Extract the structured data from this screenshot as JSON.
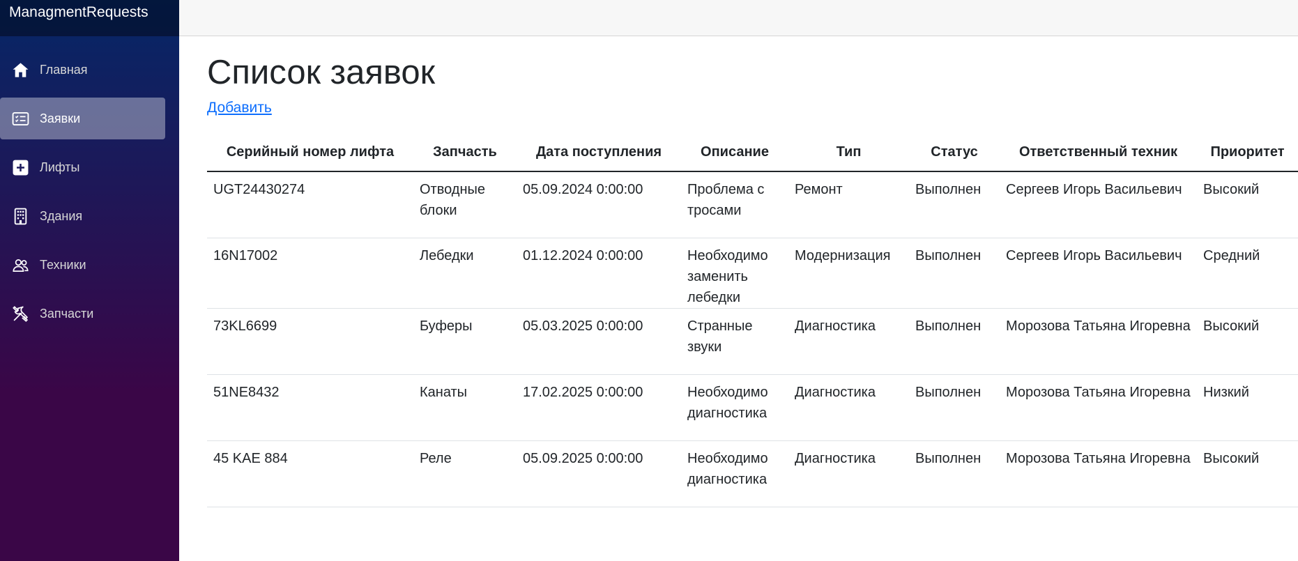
{
  "brand": "ManagmentRequests",
  "nav": [
    {
      "label": "Главная",
      "icon": "home-icon",
      "active": false
    },
    {
      "label": "Заявки",
      "icon": "list-icon",
      "active": true
    },
    {
      "label": "Лифты",
      "icon": "plus-square-icon",
      "active": false
    },
    {
      "label": "Здания",
      "icon": "building-icon",
      "active": false
    },
    {
      "label": "Техники",
      "icon": "people-icon",
      "active": false
    },
    {
      "label": "Запчасти",
      "icon": "tools-icon",
      "active": false
    }
  ],
  "page": {
    "title": "Список заявок",
    "add_link": "Добавить"
  },
  "table": {
    "headers": [
      "Серийный номер лифта",
      "Запчасть",
      "Дата поступления",
      "Описание",
      "Тип",
      "Статус",
      "Ответственный техник",
      "Приоритет"
    ],
    "rows": [
      [
        "UGT24430274",
        "Отводные блоки",
        "05.09.2024 0:00:00",
        "Проблема с тросами",
        "Ремонт",
        "Выполнен",
        "Сергеев Игорь Васильевич",
        "Высокий"
      ],
      [
        "16N17002",
        "Лебедки",
        "01.12.2024 0:00:00",
        "Необходимо заменить лебедки",
        "Модернизация",
        "Выполнен",
        "Сергеев Игорь Васильевич",
        "Средний"
      ],
      [
        "73KL6699",
        "Буферы",
        "05.03.2025 0:00:00",
        "Странные звуки",
        "Диагностика",
        "Выполнен",
        "Морозова Татьяна Игоревна",
        "Высокий"
      ],
      [
        "51NE8432",
        "Канаты",
        "17.02.2025 0:00:00",
        "Необходимо диагностика",
        "Диагностика",
        "Выполнен",
        "Морозова Татьяна Игоревна",
        "Низкий"
      ],
      [
        "45 KAE 884",
        "Реле",
        "05.09.2025 0:00:00",
        "Необходимо диагностика",
        "Диагностика",
        "Выполнен",
        "Морозова Татьяна Игоревна",
        "Высокий"
      ]
    ]
  },
  "colors": {
    "sidebar_top": "#052767",
    "sidebar_bottom": "#3a0647",
    "link": "#0d6efd"
  }
}
